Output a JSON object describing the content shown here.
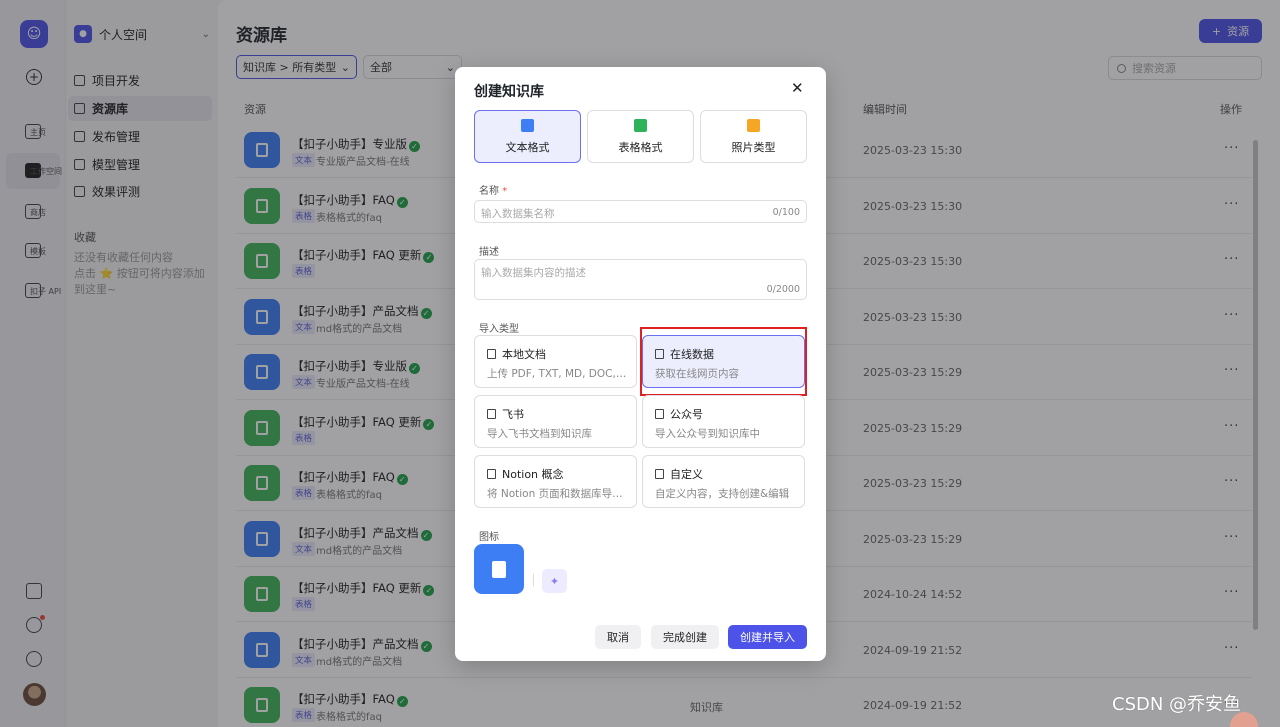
{
  "sidebar_rail": {
    "items": [
      {
        "label": "主页",
        "icon": "home-icon"
      },
      {
        "label": "工作空间",
        "icon": "terminal-icon"
      },
      {
        "label": "商店",
        "icon": "store-icon"
      },
      {
        "label": "模板",
        "icon": "template-icon"
      },
      {
        "label": "扣子 API",
        "icon": "api-link-icon"
      }
    ]
  },
  "sidebar": {
    "space_name": "个人空间",
    "nav": [
      "项目开发",
      "资源库",
      "发布管理",
      "模型管理",
      "效果评测"
    ],
    "favorites_title": "收藏",
    "favorites_empty": "还没有收藏任何内容",
    "favorites_hint": "点击 ⭐ 按钮可将内容添加到这里~"
  },
  "main": {
    "title": "资源库",
    "add_label": "资源",
    "filter_type": "知识库 > 所有类型",
    "filter_all": "全部",
    "search_placeholder": "搜索资源",
    "col_resource": "资源",
    "col_edit_time": "编辑时间",
    "col_actions": "操作",
    "more": "···",
    "rows": [
      {
        "name": "【扣子小助手】专业版",
        "kind": "doc",
        "tag": "文本",
        "desc": "专业版产品文档-在线",
        "time": "2025-03-23 15:30"
      },
      {
        "name": "【扣子小助手】FAQ",
        "kind": "tbl",
        "tag": "表格",
        "desc": "表格格式的faq",
        "time": "2025-03-23 15:30"
      },
      {
        "name": "【扣子小助手】FAQ 更新",
        "kind": "tbl",
        "tag": "表格",
        "desc": "",
        "time": "2025-03-23 15:30"
      },
      {
        "name": "【扣子小助手】产品文档",
        "kind": "doc",
        "tag": "文本",
        "desc": "md格式的产品文档",
        "time": "2025-03-23 15:30"
      },
      {
        "name": "【扣子小助手】专业版",
        "kind": "doc",
        "tag": "文本",
        "desc": "专业版产品文档-在线",
        "time": "2025-03-23 15:29"
      },
      {
        "name": "【扣子小助手】FAQ 更新",
        "kind": "tbl",
        "tag": "表格",
        "desc": "",
        "time": "2025-03-23 15:29"
      },
      {
        "name": "【扣子小助手】FAQ",
        "kind": "tbl",
        "tag": "表格",
        "desc": "表格格式的faq",
        "time": "2025-03-23 15:29"
      },
      {
        "name": "【扣子小助手】产品文档",
        "kind": "doc",
        "tag": "文本",
        "desc": "md格式的产品文档",
        "time": "2025-03-23 15:29"
      },
      {
        "name": "【扣子小助手】FAQ 更新",
        "kind": "tbl",
        "tag": "表格",
        "desc": "",
        "time": "2024-10-24 14:52"
      },
      {
        "name": "【扣子小助手】产品文档",
        "kind": "doc",
        "tag": "文本",
        "desc": "md格式的产品文档",
        "time": "2024-09-19 21:52"
      },
      {
        "name": "【扣子小助手】FAQ",
        "kind": "tbl",
        "tag": "表格",
        "desc": "表格格式的faq",
        "time": "2024-09-19 21:52",
        "type": "知识库"
      }
    ]
  },
  "modal": {
    "title": "创建知识库",
    "close": "✕",
    "formats": [
      {
        "label": "文本格式",
        "color": "#3d7ef5"
      },
      {
        "label": "表格格式",
        "color": "#2fb35a"
      },
      {
        "label": "照片类型",
        "color": "#f5a623"
      }
    ],
    "name_label": "名称",
    "name_required": "*",
    "name_placeholder": "输入数据集名称",
    "name_count": "0/100",
    "desc_label": "描述",
    "desc_placeholder": "输入数据集内容的描述",
    "desc_count": "0/2000",
    "import_label": "导入类型",
    "imports": [
      {
        "title": "本地文档",
        "desc": "上传 PDF, TXT, MD, DOC, DOCX 格式的本地文件",
        "icon": "local-doc-icon"
      },
      {
        "title": "在线数据",
        "desc": "获取在线网页内容",
        "icon": "online-data-icon"
      },
      {
        "title": "飞书",
        "desc": "导入飞书文档到知识库",
        "icon": "feishu-icon"
      },
      {
        "title": "公众号",
        "desc": "导入公众号到知识库中",
        "icon": "wechat-icon"
      },
      {
        "title": "Notion 概念",
        "desc": "将 Notion 页面和数据库导入到知识库中",
        "icon": "notion-icon"
      },
      {
        "title": "自定义",
        "desc": "自定义内容，支持创建&编辑",
        "icon": "custom-icon"
      }
    ],
    "icon_label": "图标",
    "cancel": "取消",
    "finish": "完成创建",
    "create_import": "创建并导入"
  },
  "watermark": "CSDN @乔安鱼"
}
